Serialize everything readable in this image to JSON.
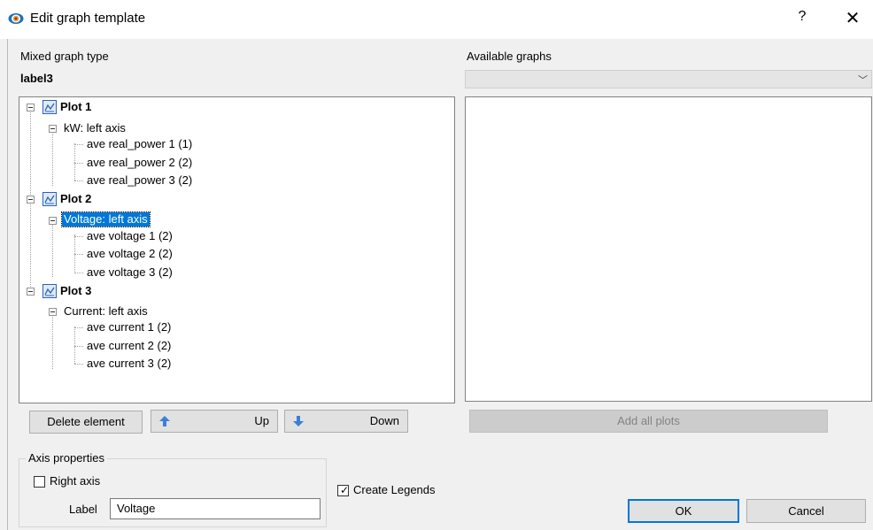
{
  "window": {
    "title": "Edit graph template",
    "help": "?",
    "close": "✕"
  },
  "left_panel": {
    "type_label": "Mixed graph type",
    "selected_name": "label3"
  },
  "right_panel": {
    "available_label": "Available graphs",
    "combo_value": "",
    "combo_arrow": "﹀"
  },
  "tree": {
    "plots": [
      {
        "name": "Plot 1",
        "axis": "kW: left axis",
        "items": [
          "ave real_power 1  (1)",
          "ave real_power 2  (2)",
          "ave real_power 3  (2)"
        ]
      },
      {
        "name": "Plot 2",
        "axis": "Voltage: left axis",
        "items": [
          "ave voltage 1  (2)",
          "ave voltage 2  (2)",
          "ave voltage 3  (2)"
        ]
      },
      {
        "name": "Plot 3",
        "axis": "Current: left axis",
        "items": [
          "ave current 1  (2)",
          "ave current 2  (2)",
          "ave current 3  (2)"
        ]
      }
    ],
    "selected": "Voltage: left axis"
  },
  "buttons": {
    "delete": "Delete element",
    "up": "Up",
    "down": "Down",
    "add_all": "Add all plots",
    "ok": "OK",
    "cancel": "Cancel"
  },
  "axis_properties": {
    "title": "Axis properties",
    "right_axis_label": "Right axis",
    "right_axis_checked": false,
    "label_caption": "Label",
    "label_value": "Voltage"
  },
  "create_legends": {
    "label": "Create Legends",
    "checked": true
  },
  "colors": {
    "selection": "#0078d7",
    "arrow_blue": "#3c7fd6",
    "plot_icon_frame": "#2c62b5"
  }
}
